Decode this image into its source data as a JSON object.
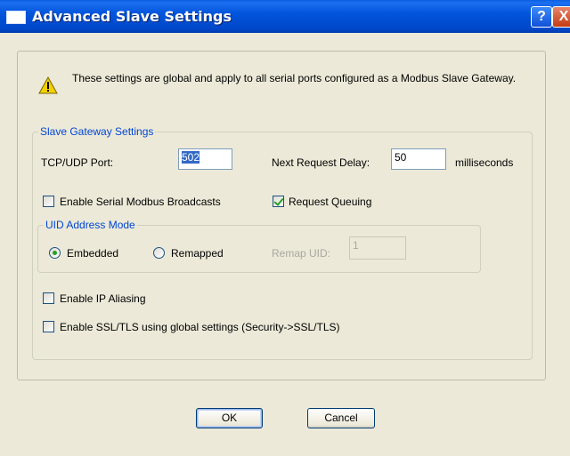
{
  "window": {
    "title": "Advanced Slave Settings",
    "help_glyph": "?",
    "close_glyph": "X",
    "icon": "window-icon"
  },
  "info": {
    "icon": "warning-icon",
    "text": "These settings are global and apply to all serial ports configured as a Modbus Slave Gateway."
  },
  "gateway": {
    "legend": "Slave Gateway Settings",
    "tcp_port_label": "TCP/UDP Port:",
    "tcp_port_value": "502",
    "delay_label": "Next Request Delay:",
    "delay_value": "50",
    "delay_unit": "milliseconds",
    "broadcast_label": "Enable Serial Modbus Broadcasts",
    "broadcast_checked": false,
    "queuing_label": "Request Queuing",
    "queuing_checked": true,
    "uid": {
      "legend": "UID Address Mode",
      "embedded_label": "Embedded",
      "remapped_label": "Remapped",
      "selected": "Embedded",
      "remap_label": "Remap UID:",
      "remap_value": "1"
    },
    "ip_alias_label": "Enable IP Aliasing",
    "ip_alias_checked": false,
    "ssl_label": "Enable SSL/TLS using global settings (Security->SSL/TLS)",
    "ssl_checked": false
  },
  "buttons": {
    "ok": "OK",
    "cancel": "Cancel"
  },
  "colors": {
    "titlebar": "#0055e5",
    "dialog_bg": "#ece9d8",
    "group_legend": "#0046d5",
    "check_mark": "#21a121",
    "selection": "#316ac5"
  }
}
